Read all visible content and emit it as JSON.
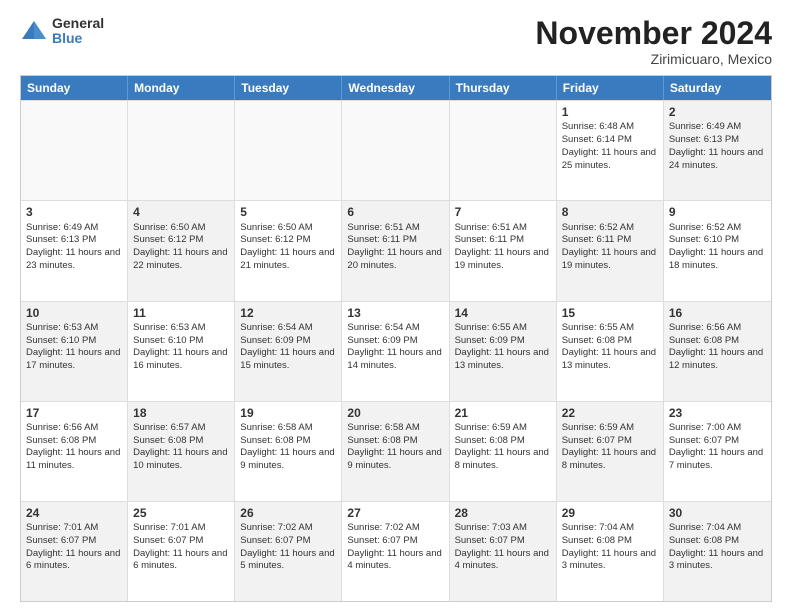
{
  "logo": {
    "general": "General",
    "blue": "Blue"
  },
  "header": {
    "title": "November 2024",
    "subtitle": "Zirimicuaro, Mexico"
  },
  "days": [
    "Sunday",
    "Monday",
    "Tuesday",
    "Wednesday",
    "Thursday",
    "Friday",
    "Saturday"
  ],
  "weeks": [
    [
      {
        "day": "",
        "info": "",
        "shaded": false,
        "empty": true
      },
      {
        "day": "",
        "info": "",
        "shaded": false,
        "empty": true
      },
      {
        "day": "",
        "info": "",
        "shaded": false,
        "empty": true
      },
      {
        "day": "",
        "info": "",
        "shaded": false,
        "empty": true
      },
      {
        "day": "",
        "info": "",
        "shaded": false,
        "empty": true
      },
      {
        "day": "1",
        "info": "Sunrise: 6:48 AM\nSunset: 6:14 PM\nDaylight: 11 hours and 25 minutes.",
        "shaded": false,
        "empty": false
      },
      {
        "day": "2",
        "info": "Sunrise: 6:49 AM\nSunset: 6:13 PM\nDaylight: 11 hours and 24 minutes.",
        "shaded": true,
        "empty": false
      }
    ],
    [
      {
        "day": "3",
        "info": "Sunrise: 6:49 AM\nSunset: 6:13 PM\nDaylight: 11 hours and 23 minutes.",
        "shaded": false,
        "empty": false
      },
      {
        "day": "4",
        "info": "Sunrise: 6:50 AM\nSunset: 6:12 PM\nDaylight: 11 hours and 22 minutes.",
        "shaded": true,
        "empty": false
      },
      {
        "day": "5",
        "info": "Sunrise: 6:50 AM\nSunset: 6:12 PM\nDaylight: 11 hours and 21 minutes.",
        "shaded": false,
        "empty": false
      },
      {
        "day": "6",
        "info": "Sunrise: 6:51 AM\nSunset: 6:11 PM\nDaylight: 11 hours and 20 minutes.",
        "shaded": true,
        "empty": false
      },
      {
        "day": "7",
        "info": "Sunrise: 6:51 AM\nSunset: 6:11 PM\nDaylight: 11 hours and 19 minutes.",
        "shaded": false,
        "empty": false
      },
      {
        "day": "8",
        "info": "Sunrise: 6:52 AM\nSunset: 6:11 PM\nDaylight: 11 hours and 19 minutes.",
        "shaded": true,
        "empty": false
      },
      {
        "day": "9",
        "info": "Sunrise: 6:52 AM\nSunset: 6:10 PM\nDaylight: 11 hours and 18 minutes.",
        "shaded": false,
        "empty": false
      }
    ],
    [
      {
        "day": "10",
        "info": "Sunrise: 6:53 AM\nSunset: 6:10 PM\nDaylight: 11 hours and 17 minutes.",
        "shaded": true,
        "empty": false
      },
      {
        "day": "11",
        "info": "Sunrise: 6:53 AM\nSunset: 6:10 PM\nDaylight: 11 hours and 16 minutes.",
        "shaded": false,
        "empty": false
      },
      {
        "day": "12",
        "info": "Sunrise: 6:54 AM\nSunset: 6:09 PM\nDaylight: 11 hours and 15 minutes.",
        "shaded": true,
        "empty": false
      },
      {
        "day": "13",
        "info": "Sunrise: 6:54 AM\nSunset: 6:09 PM\nDaylight: 11 hours and 14 minutes.",
        "shaded": false,
        "empty": false
      },
      {
        "day": "14",
        "info": "Sunrise: 6:55 AM\nSunset: 6:09 PM\nDaylight: 11 hours and 13 minutes.",
        "shaded": true,
        "empty": false
      },
      {
        "day": "15",
        "info": "Sunrise: 6:55 AM\nSunset: 6:08 PM\nDaylight: 11 hours and 13 minutes.",
        "shaded": false,
        "empty": false
      },
      {
        "day": "16",
        "info": "Sunrise: 6:56 AM\nSunset: 6:08 PM\nDaylight: 11 hours and 12 minutes.",
        "shaded": true,
        "empty": false
      }
    ],
    [
      {
        "day": "17",
        "info": "Sunrise: 6:56 AM\nSunset: 6:08 PM\nDaylight: 11 hours and 11 minutes.",
        "shaded": false,
        "empty": false
      },
      {
        "day": "18",
        "info": "Sunrise: 6:57 AM\nSunset: 6:08 PM\nDaylight: 11 hours and 10 minutes.",
        "shaded": true,
        "empty": false
      },
      {
        "day": "19",
        "info": "Sunrise: 6:58 AM\nSunset: 6:08 PM\nDaylight: 11 hours and 9 minutes.",
        "shaded": false,
        "empty": false
      },
      {
        "day": "20",
        "info": "Sunrise: 6:58 AM\nSunset: 6:08 PM\nDaylight: 11 hours and 9 minutes.",
        "shaded": true,
        "empty": false
      },
      {
        "day": "21",
        "info": "Sunrise: 6:59 AM\nSunset: 6:08 PM\nDaylight: 11 hours and 8 minutes.",
        "shaded": false,
        "empty": false
      },
      {
        "day": "22",
        "info": "Sunrise: 6:59 AM\nSunset: 6:07 PM\nDaylight: 11 hours and 8 minutes.",
        "shaded": true,
        "empty": false
      },
      {
        "day": "23",
        "info": "Sunrise: 7:00 AM\nSunset: 6:07 PM\nDaylight: 11 hours and 7 minutes.",
        "shaded": false,
        "empty": false
      }
    ],
    [
      {
        "day": "24",
        "info": "Sunrise: 7:01 AM\nSunset: 6:07 PM\nDaylight: 11 hours and 6 minutes.",
        "shaded": true,
        "empty": false
      },
      {
        "day": "25",
        "info": "Sunrise: 7:01 AM\nSunset: 6:07 PM\nDaylight: 11 hours and 6 minutes.",
        "shaded": false,
        "empty": false
      },
      {
        "day": "26",
        "info": "Sunrise: 7:02 AM\nSunset: 6:07 PM\nDaylight: 11 hours and 5 minutes.",
        "shaded": true,
        "empty": false
      },
      {
        "day": "27",
        "info": "Sunrise: 7:02 AM\nSunset: 6:07 PM\nDaylight: 11 hours and 4 minutes.",
        "shaded": false,
        "empty": false
      },
      {
        "day": "28",
        "info": "Sunrise: 7:03 AM\nSunset: 6:07 PM\nDaylight: 11 hours and 4 minutes.",
        "shaded": true,
        "empty": false
      },
      {
        "day": "29",
        "info": "Sunrise: 7:04 AM\nSunset: 6:08 PM\nDaylight: 11 hours and 3 minutes.",
        "shaded": false,
        "empty": false
      },
      {
        "day": "30",
        "info": "Sunrise: 7:04 AM\nSunset: 6:08 PM\nDaylight: 11 hours and 3 minutes.",
        "shaded": true,
        "empty": false
      }
    ]
  ]
}
